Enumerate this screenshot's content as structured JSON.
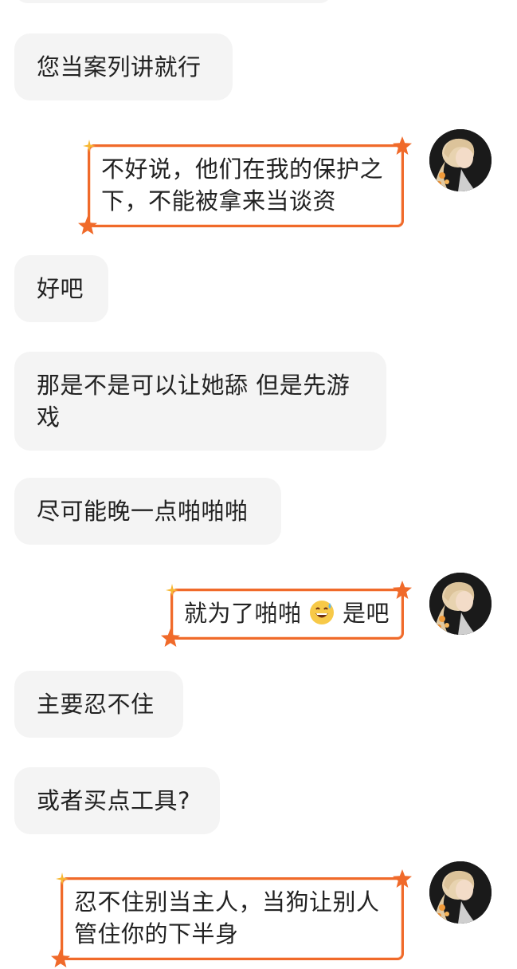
{
  "conversation": {
    "messages": [
      {
        "side": "left",
        "text": "您当案列讲就行"
      },
      {
        "side": "right",
        "text": "不好说，他们在我的保护之下，不能被拿来当谈资"
      },
      {
        "side": "left",
        "text": "好吧"
      },
      {
        "side": "left",
        "text": "那是不是可以让她舔 但是先游戏"
      },
      {
        "side": "left",
        "text": "尽可能晚一点啪啪啪"
      },
      {
        "side": "right",
        "text_before": "就为了啪啪",
        "emoji": "grinning-face-with-sweat",
        "text_after": "是吧"
      },
      {
        "side": "left",
        "text": "主要忍不住"
      },
      {
        "side": "left",
        "text": "或者买点工具?"
      },
      {
        "side": "right",
        "text": "忍不住别当主人，当狗让别人管住你的下半身"
      }
    ]
  },
  "theme": {
    "left_bubble_bg": "#f4f4f4",
    "right_bubble_border": "#f06a2a",
    "text_color": "#222222"
  },
  "icons": {
    "bubble_decoration_star": "star-icon",
    "bubble_decoration_spark": "sparkle-icon",
    "avatar": "user-avatar-illustrated-girl"
  }
}
